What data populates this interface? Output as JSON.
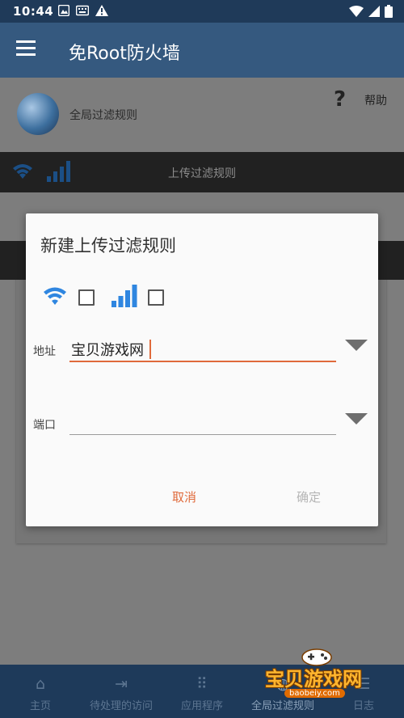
{
  "status_bar": {
    "time": "10:44",
    "left_icons": [
      "photo-notification-icon",
      "keyboard-notification-icon",
      "warning-notification-icon"
    ],
    "right_icons": [
      "wifi-signal-icon",
      "cell-signal-icon",
      "battery-icon"
    ]
  },
  "toolbar": {
    "title": "免Root防火墙",
    "menu_icon": "hamburger-menu-icon"
  },
  "page": {
    "global_rules_label": "全局过滤规则",
    "help_label": "帮助",
    "upload_rules_label": "上传过滤规则"
  },
  "dialog": {
    "title": "新建上传过滤规则",
    "wifi_checked": false,
    "mobile_checked": false,
    "address_label": "地址",
    "address_value": "宝贝游戏网",
    "port_label": "端口",
    "port_value": "",
    "cancel_label": "取消",
    "confirm_label": "确定"
  },
  "bottom_nav": {
    "items": [
      {
        "label": "主页",
        "icon": "home-icon"
      },
      {
        "label": "待处理的访问",
        "icon": "arrow-to-bar-icon"
      },
      {
        "label": "应用程序",
        "icon": "apps-grid-icon"
      },
      {
        "label": "全局过滤规则",
        "icon": "globe-icon"
      },
      {
        "label": "日志",
        "icon": "log-icon"
      }
    ]
  },
  "watermark": {
    "text": "宝贝游戏网",
    "url": "baobeiy.com"
  },
  "colors": {
    "status_bar": "#1f3a59",
    "toolbar": "#35597f",
    "accent": "#e06a3b",
    "wifi_blue": "#2f86e0",
    "dim_overlay_bg": "#7d7d7d"
  }
}
